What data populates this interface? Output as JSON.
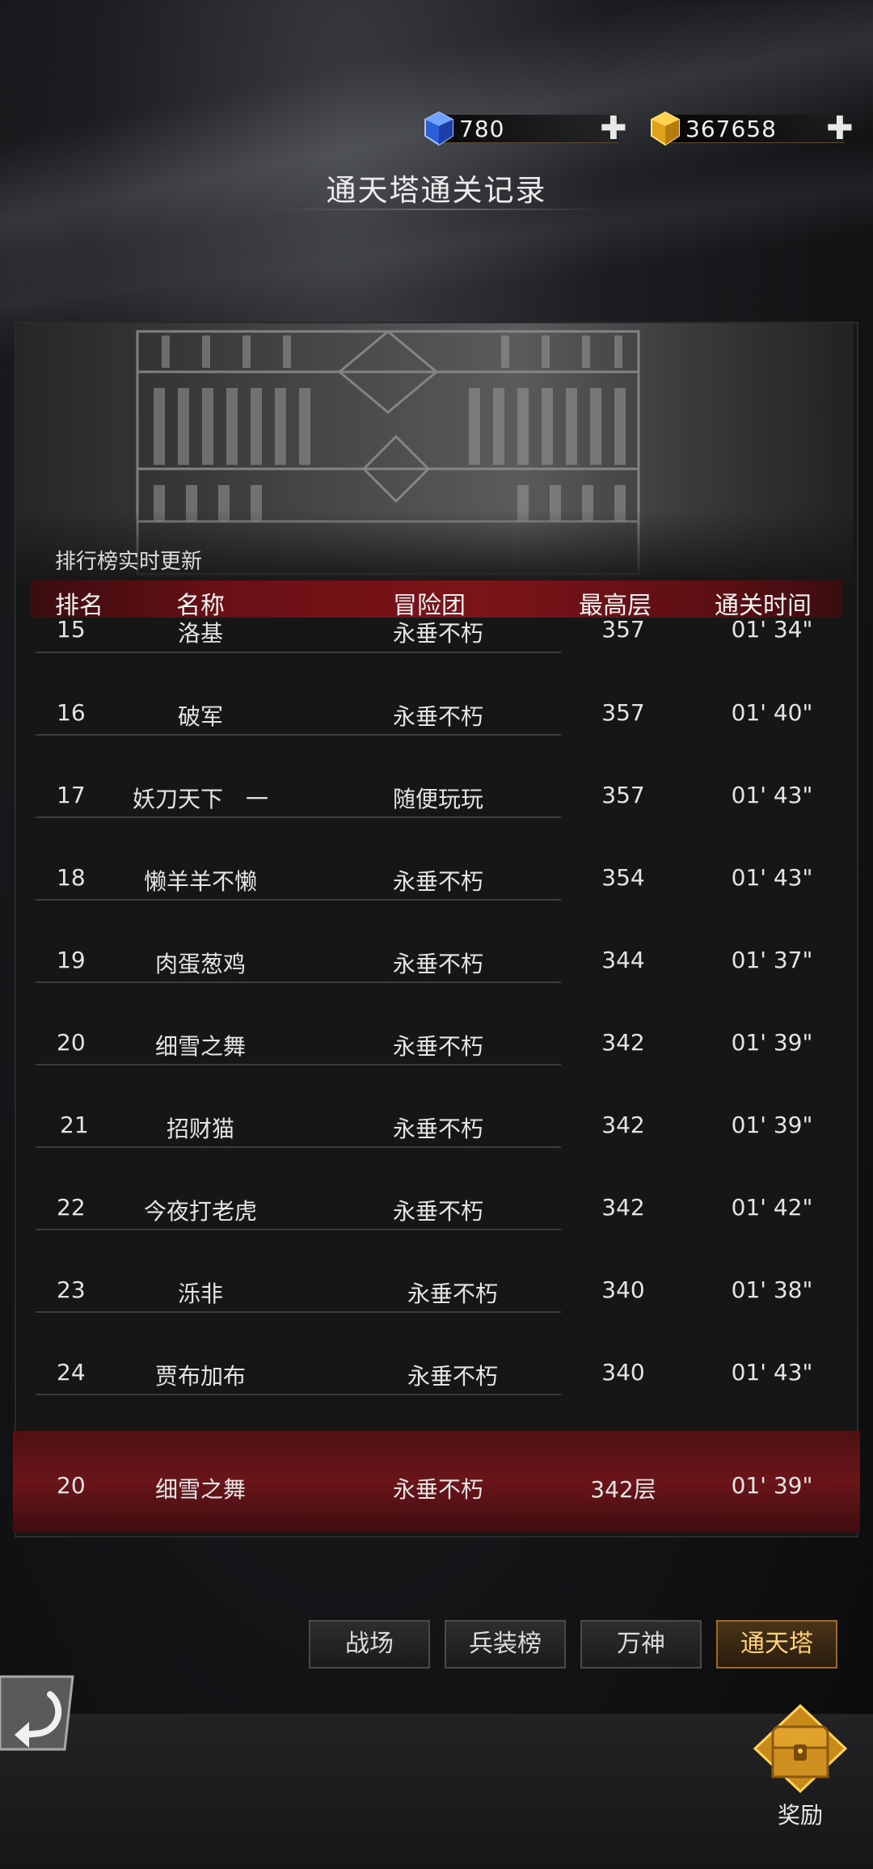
{
  "currency": {
    "diamond_value": "780",
    "diamond_icon": "blue-gem-icon",
    "gold_value": "367658",
    "gold_icon": "gold-gem-icon",
    "plus": "✚"
  },
  "page_title": "通天塔通关记录",
  "realtime_label": "排行榜实时更新",
  "table": {
    "headers": [
      "排名",
      "名称",
      "冒险团",
      "最高层",
      "通关时间"
    ],
    "rows": [
      {
        "rank": "15",
        "name": "洛基",
        "guild": "永垂不朽",
        "floor": "357",
        "time": "01' 34\""
      },
      {
        "rank": "16",
        "name": "破军",
        "guild": "永垂不朽",
        "floor": "357",
        "time": "01' 40\""
      },
      {
        "rank": "17",
        "name": "妖刀天下　一",
        "guild": "随便玩玩",
        "floor": "357",
        "time": "01' 43\""
      },
      {
        "rank": "18",
        "name": "懒羊羊不懒",
        "guild": "永垂不朽",
        "floor": "354",
        "time": "01' 43\""
      },
      {
        "rank": "19",
        "name": "肉蛋葱鸡",
        "guild": "永垂不朽",
        "floor": "344",
        "time": "01' 37\""
      },
      {
        "rank": "20",
        "name": "细雪之舞",
        "guild": "永垂不朽",
        "floor": "342",
        "time": "01' 39\""
      },
      {
        "rank": "21",
        "name": "招财猫",
        "guild": "永垂不朽",
        "floor": "342",
        "time": "01' 39\""
      },
      {
        "rank": "22",
        "name": "今夜打老虎",
        "guild": "永垂不朽",
        "floor": "342",
        "time": "01' 42\""
      },
      {
        "rank": "23",
        "name": "泺非",
        "guild": "永垂不朽",
        "floor": "340",
        "time": "01' 38\""
      },
      {
        "rank": "24",
        "name": "贾布加布",
        "guild": "永垂不朽",
        "floor": "340",
        "time": "01' 43\""
      }
    ]
  },
  "my_record": {
    "rank": "20",
    "name": "细雪之舞",
    "guild": "永垂不朽",
    "floor": "342层",
    "time": "01' 39\""
  },
  "tabs": [
    "战场",
    "兵装榜",
    "万神",
    "通天塔"
  ],
  "active_tab": "通天塔",
  "reward_label": "奖励",
  "icons": {
    "back": "back-arrow-icon",
    "reward": "treasure-chest-icon"
  },
  "colors": {
    "header_red": "#7b1419",
    "active_tab_gold": "#ffd27a",
    "my_row_red": "#6a1519"
  }
}
